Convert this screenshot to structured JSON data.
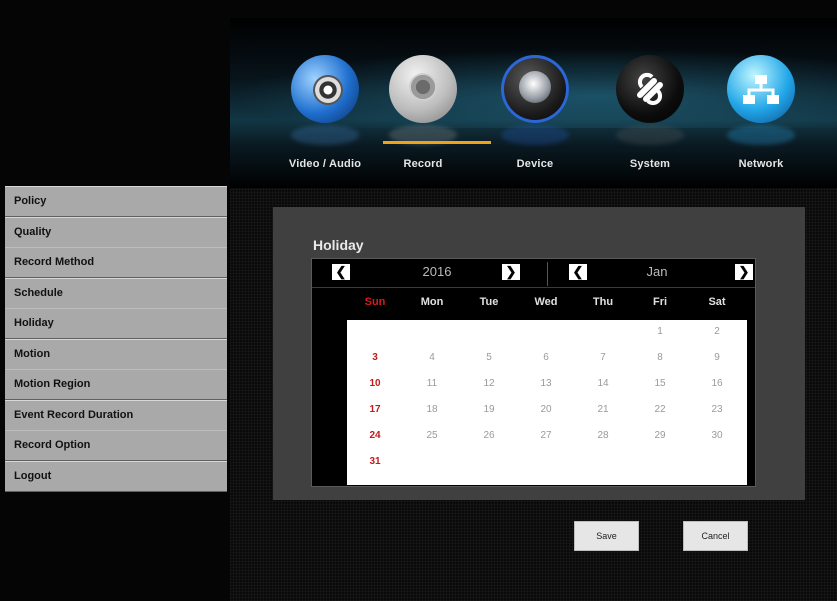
{
  "nav": {
    "items": [
      {
        "label": "Video / Audio",
        "icon": "video-audio-icon"
      },
      {
        "label": "Record",
        "icon": "record-icon"
      },
      {
        "label": "Device",
        "icon": "device-icon"
      },
      {
        "label": "System",
        "icon": "system-icon"
      },
      {
        "label": "Network",
        "icon": "network-icon"
      }
    ],
    "active": "Record",
    "accent": "#f0a318"
  },
  "sidebar": {
    "items": [
      {
        "label": "Policy"
      },
      {
        "label": "Quality"
      },
      {
        "label": "Record Method"
      },
      {
        "label": "Schedule"
      },
      {
        "label": "Holiday"
      },
      {
        "label": "Motion"
      },
      {
        "label": "Motion Region"
      },
      {
        "label": "Event Record Duration"
      },
      {
        "label": "Record Option"
      },
      {
        "label": "Logout"
      }
    ],
    "active": "Holiday"
  },
  "panel": {
    "title": "Holiday"
  },
  "calendar": {
    "year": "2016",
    "month": "Jan",
    "prev_symbol": "❮",
    "next_symbol": "❯",
    "weekdays": [
      "Sun",
      "Mon",
      "Tue",
      "Wed",
      "Thu",
      "Fri",
      "Sat"
    ],
    "days": [
      [
        "",
        "",
        "",
        "",
        "",
        "1",
        "2"
      ],
      [
        "3",
        "4",
        "5",
        "6",
        "7",
        "8",
        "9"
      ],
      [
        "10",
        "11",
        "12",
        "13",
        "14",
        "15",
        "16"
      ],
      [
        "17",
        "18",
        "19",
        "20",
        "21",
        "22",
        "23"
      ],
      [
        "24",
        "25",
        "26",
        "27",
        "28",
        "29",
        "30"
      ],
      [
        "31",
        "",
        "",
        "",
        "",
        "",
        ""
      ]
    ]
  },
  "buttons": {
    "save": "Save",
    "cancel": "Cancel"
  }
}
